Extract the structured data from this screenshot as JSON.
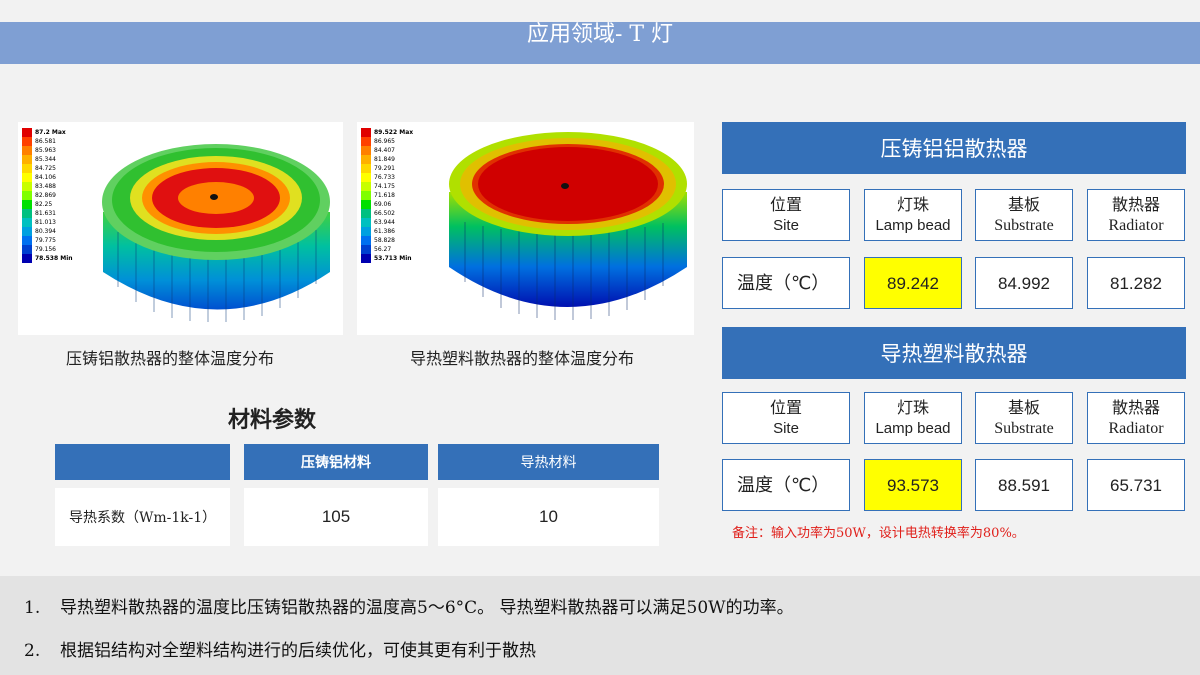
{
  "title": "应用领域- T 灯",
  "images": [
    {
      "caption": "压铸铝散热器的整体温度分布",
      "legend": [
        "87.2 Max",
        "86.581",
        "85.963",
        "85.344",
        "84.725",
        "84.106",
        "83.488",
        "82.869",
        "82.25",
        "81.631",
        "81.013",
        "80.394",
        "79.775",
        "79.156",
        "78.538 Min"
      ]
    },
    {
      "caption": "导热塑料散热器的整体温度分布",
      "legend": [
        "89.522 Max",
        "86.965",
        "84.407",
        "81.849",
        "79.291",
        "76.733",
        "74.175",
        "71.618",
        "69.06",
        "66.502",
        "63.944",
        "61.386",
        "58.828",
        "56.27",
        "53.713 Min"
      ]
    }
  ],
  "legend_colors": [
    "#e00000",
    "#ff4000",
    "#ff8000",
    "#ffb000",
    "#ffd800",
    "#ffff00",
    "#c8ff00",
    "#80ff00",
    "#00e000",
    "#00c080",
    "#00c0c0",
    "#00a0e0",
    "#0070f0",
    "#0040d0",
    "#0000b0"
  ],
  "materials": {
    "title": "材料参数",
    "headers": [
      "",
      "压铸铝材料",
      "导热材料"
    ],
    "row_label": "导热系数（Wm-1k-1）",
    "values": [
      "105",
      "10"
    ]
  },
  "tables": [
    {
      "banner": "压铸铝铝散热器",
      "headers": [
        {
          "zh": "位置",
          "en": "Site"
        },
        {
          "zh": "灯珠",
          "en": "Lamp bead"
        },
        {
          "zh": "基板",
          "en": "Substrate"
        },
        {
          "zh": "散热器",
          "en": "Radiator"
        }
      ],
      "row_label": "温度（℃）",
      "values": [
        "89.242",
        "84.992",
        "81.282"
      ]
    },
    {
      "banner": "导热塑料散热器",
      "headers": [
        {
          "zh": "位置",
          "en": "Site"
        },
        {
          "zh": "灯珠",
          "en": "Lamp bead"
        },
        {
          "zh": "基板",
          "en": "Substrate"
        },
        {
          "zh": "散热器",
          "en": "Radiator"
        }
      ],
      "row_label": "温度（℃）",
      "values": [
        "93.573",
        "88.591",
        "65.731"
      ]
    }
  ],
  "note": "备注：输入功率为50W，设计电热转换率为80%。",
  "conclusions": [
    {
      "num": "1.",
      "text": "导热塑料散热器的温度比压铸铝散热器的温度高5～6°C。 导热塑料散热器可以满足50W的功率。"
    },
    {
      "num": "2.",
      "text": "根据铝结构对全塑料结构进行的后续优化，可使其更有利于散热"
    }
  ],
  "colors": {
    "title_bar": "#7f9fd3",
    "header_blue": "#3470b8",
    "highlight": "#ffff00",
    "note_red": "#e0201b"
  }
}
